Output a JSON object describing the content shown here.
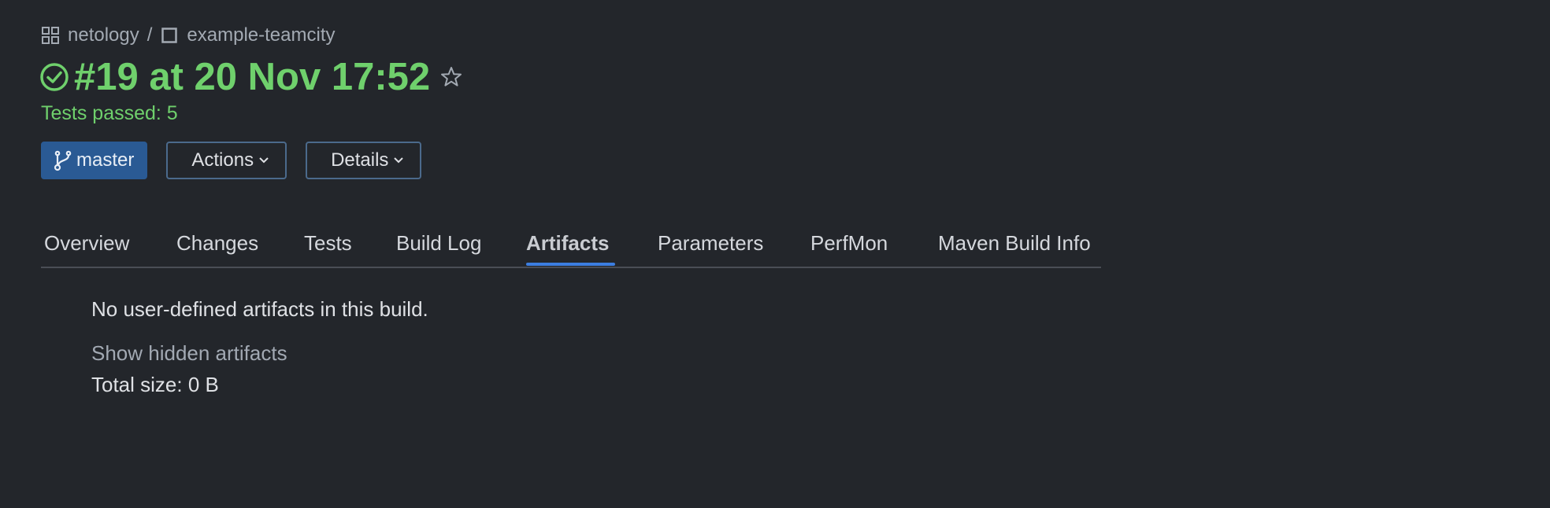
{
  "breadcrumb": {
    "project": "netology",
    "separator": "/",
    "build_config": "example-teamcity"
  },
  "build": {
    "title": "#19 at 20 Nov 17:52",
    "tests_status": "Tests passed: 5",
    "status_color": "#6fd06c"
  },
  "buttons": {
    "branch": "master",
    "actions": "Actions",
    "details": "Details"
  },
  "tabs": [
    {
      "label": "Overview",
      "active": false
    },
    {
      "label": "Changes",
      "active": false
    },
    {
      "label": "Tests",
      "active": false
    },
    {
      "label": "Build Log",
      "active": false
    },
    {
      "label": "Artifacts",
      "active": true
    },
    {
      "label": "Parameters",
      "active": false
    },
    {
      "label": "PerfMon",
      "active": false
    },
    {
      "label": "Maven Build Info",
      "active": false
    }
  ],
  "artifacts": {
    "message": "No user-defined artifacts in this build.",
    "show_hidden": "Show hidden artifacts",
    "total_size": "Total size: 0 B"
  },
  "colors": {
    "background": "#23262b",
    "accent": "#3c7ee0",
    "branch_bg": "#2a5a94",
    "success": "#6fd06c"
  },
  "icons": {
    "project": "project-grid-icon",
    "build_config": "build-config-square-icon",
    "status": "success-check-circle-icon",
    "favorite": "star-icon",
    "branch": "git-branch-icon",
    "dropdown": "chevron-down-icon"
  }
}
